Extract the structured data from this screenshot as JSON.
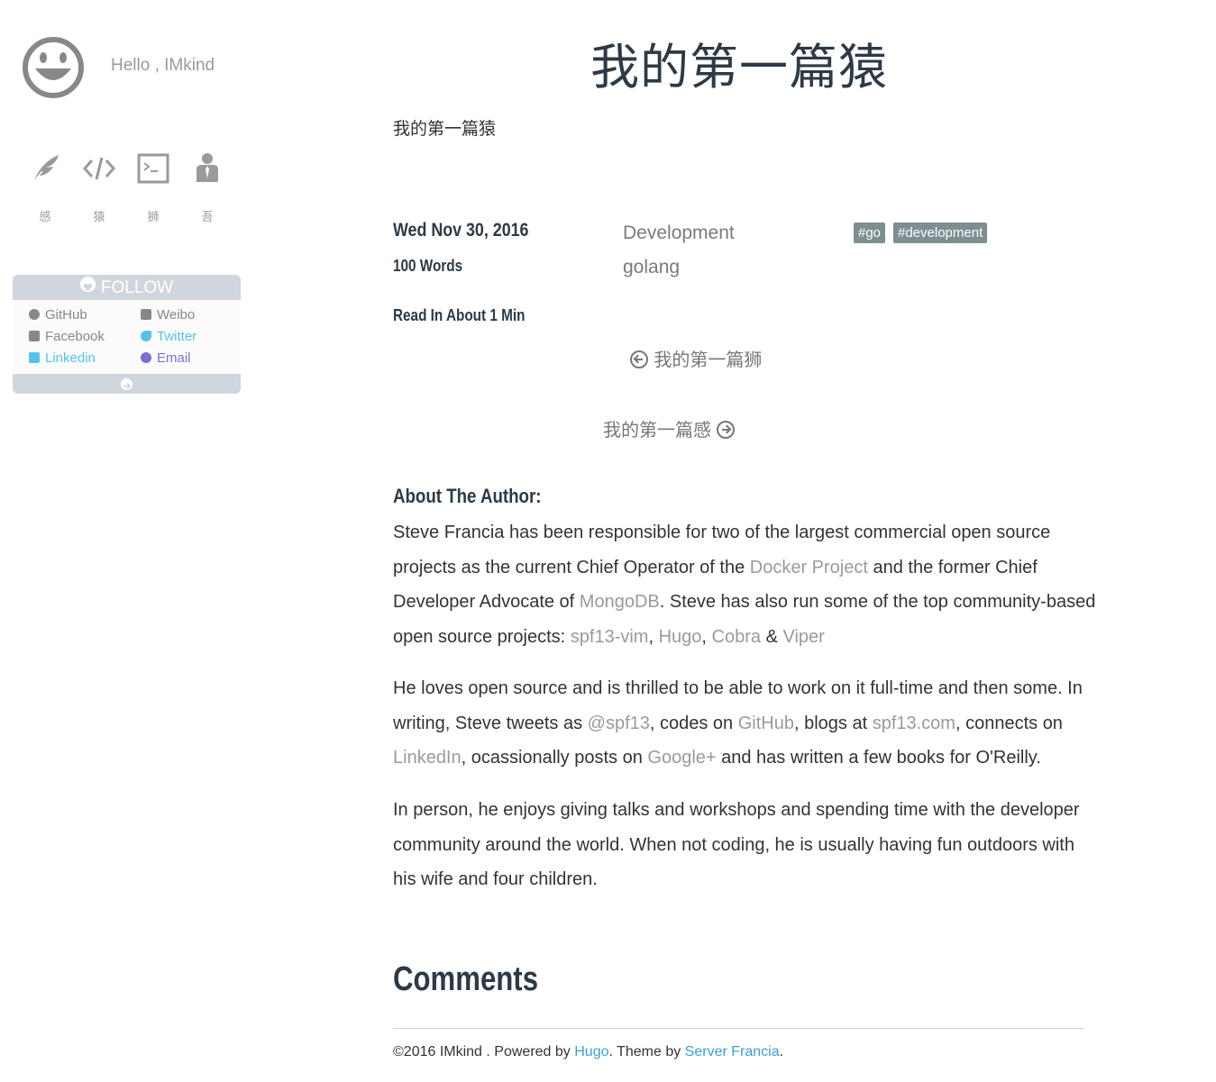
{
  "sidebar": {
    "greeting": "Hello , IMkind",
    "nav": [
      {
        "label": "感",
        "icon": "feather-icon"
      },
      {
        "label": "猿",
        "icon": "code-icon"
      },
      {
        "label": "狮",
        "icon": "terminal-icon"
      },
      {
        "label": "吾",
        "icon": "person-icon"
      }
    ],
    "follow": {
      "title": "FOLLOW",
      "links": [
        {
          "label": "GitHub",
          "icon": "github-icon",
          "color": "#888888"
        },
        {
          "label": "Weibo",
          "icon": "weibo-icon",
          "color": "#888888"
        },
        {
          "label": "Facebook",
          "icon": "facebook-icon",
          "color": "#888888"
        },
        {
          "label": "Twitter",
          "icon": "twitter-icon",
          "color": "#55c3e8"
        },
        {
          "label": "Linkedin",
          "icon": "linkedin-icon",
          "color": "#55c3e8"
        },
        {
          "label": "Email",
          "icon": "email-icon",
          "color": "#7a6fd6"
        }
      ]
    }
  },
  "post": {
    "title": "我的第一篇猿",
    "summary": "我的第一篇猿",
    "date": "Wed Nov 30, 2016",
    "words": "100 Words",
    "read_time": "Read In About 1 Min",
    "categories": [
      "Development",
      "golang"
    ],
    "tags": [
      "#go",
      "#development"
    ],
    "prev": "我的第一篇狮",
    "next": "我的第一篇感"
  },
  "about": {
    "heading": "About The Author:",
    "p1": {
      "t1": "Steve Francia has been responsible for two of the largest commercial open source projects as the current Chief Operator of the ",
      "docker": "Docker Project",
      "t2": " and the former Chief Developer Advocate of ",
      "mongodb": "MongoDB",
      "t3": ". Steve has also run some of the top community-based open source projects: ",
      "spf13vim": "spf13-vim",
      "sep1": ", ",
      "hugo": "Hugo",
      "sep2": ", ",
      "cobra": "Cobra",
      "amp": " & ",
      "viper": "Viper"
    },
    "p2": {
      "t1": "He loves open source and is thrilled to be able to work on it full-time and then some. In writing, Steve tweets as ",
      "spf13": "@spf13",
      "t2": ", codes on ",
      "github": "GitHub",
      "t3": ", blogs at ",
      "site": "spf13.com",
      "t4": ", connects on ",
      "linkedin": "LinkedIn",
      "t5": ", ocassionally posts on ",
      "gplus": "Google+",
      "t6": " and has written a few books for O'Reilly."
    },
    "p3": "In person, he enjoys giving talks and workshops and spending time with the developer community around the world. When not coding, he is usually having fun outdoors with his wife and four children."
  },
  "comments_heading": "Comments",
  "footer": {
    "copy": "©2016 IMkind . Powered by ",
    "hugo": "Hugo",
    "mid": ". Theme by ",
    "author": "Server Francia",
    "end": "."
  }
}
